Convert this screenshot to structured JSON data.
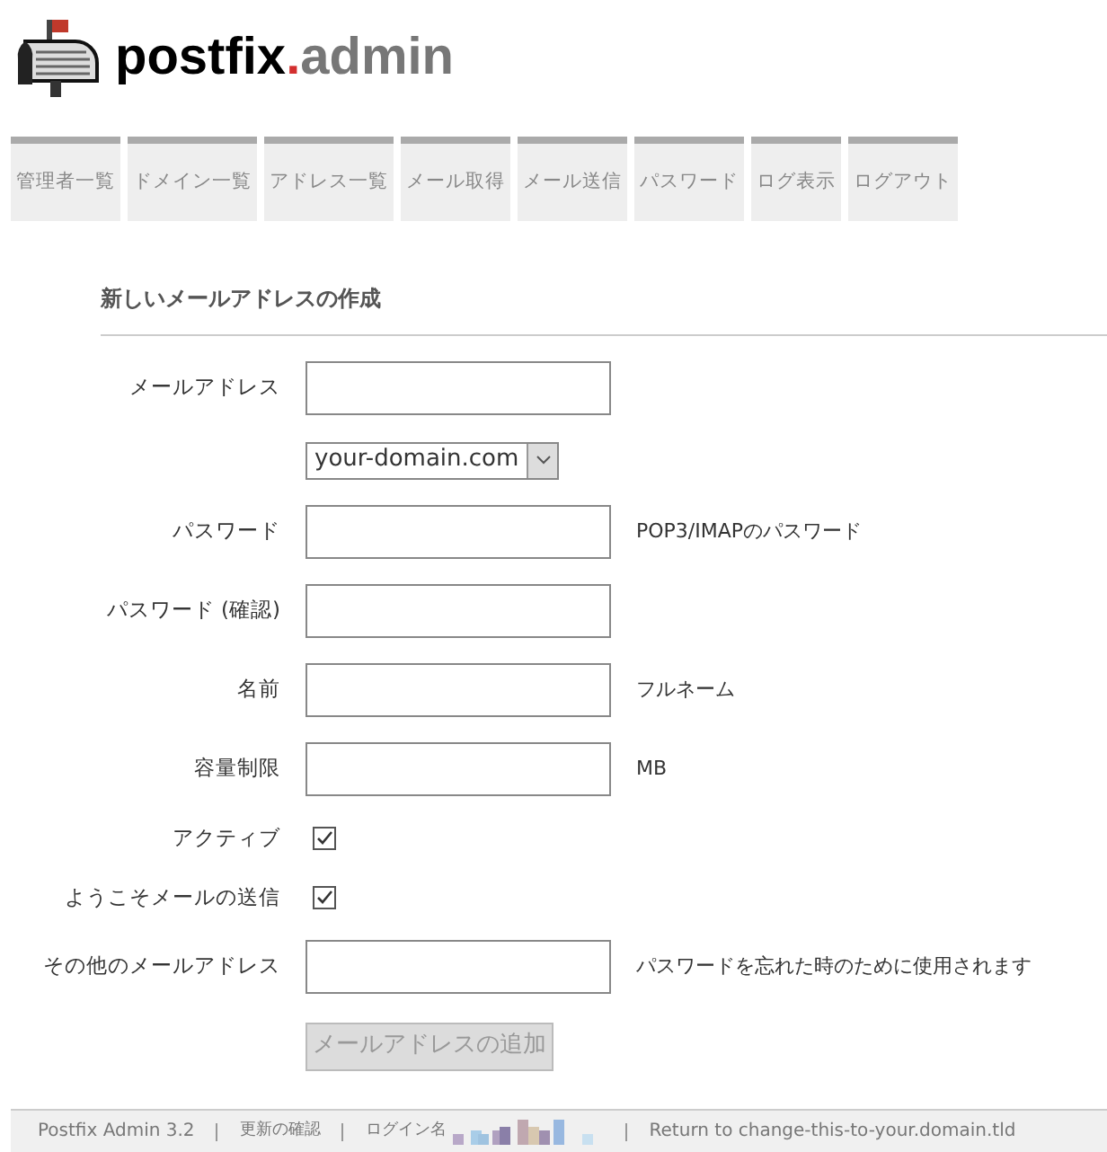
{
  "logo": {
    "main": "postfix",
    "dot": ".",
    "sub": "admin"
  },
  "nav": [
    {
      "label": "管理者一覧"
    },
    {
      "label": "ドメイン一覧"
    },
    {
      "label": "アドレス一覧"
    },
    {
      "label": "メール取得"
    },
    {
      "label": "メール送信"
    },
    {
      "label": "パスワード"
    },
    {
      "label": "ログ表示"
    },
    {
      "label": "ログアウト"
    }
  ],
  "form": {
    "title": "新しいメールアドレスの作成",
    "rows": [
      {
        "kind": "text",
        "label": "メールアドレス"
      },
      {
        "kind": "select",
        "value": "your-domain.com"
      },
      {
        "kind": "text",
        "label": "パスワード",
        "hint": "POP3/IMAPのパスワード"
      },
      {
        "kind": "text",
        "label": "パスワード (確認)"
      },
      {
        "kind": "text",
        "label": "名前",
        "hint": "フルネーム"
      },
      {
        "kind": "text",
        "label": "容量制限",
        "hint": "MB"
      },
      {
        "kind": "checkbox",
        "label": "アクティブ",
        "checked": true
      },
      {
        "kind": "checkbox",
        "label": "ようこそメールの送信",
        "checked": true
      },
      {
        "kind": "text",
        "label": "その他のメールアドレス",
        "hint": "パスワードを忘れた時のために使用されます"
      },
      {
        "kind": "button",
        "label": "メールアドレスの追加",
        "disabled": true
      }
    ]
  },
  "footer": [
    {
      "kind": "text",
      "text": "Postfix Admin 3.2"
    },
    {
      "kind": "link",
      "text": "更新の確認"
    },
    {
      "kind": "login",
      "text": "ログイン名"
    },
    {
      "kind": "link",
      "text": "Return to change-this-to-your.domain.tld"
    }
  ]
}
